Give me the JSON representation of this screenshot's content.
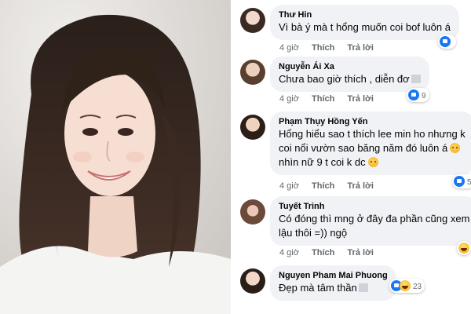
{
  "comments": [
    {
      "name": "Thư Hin",
      "text_lines": [
        "Vì bà ý mà t hổng muốn coi bof luôn á"
      ],
      "time": "4 giờ",
      "like_label": "Thích",
      "reply_label": "Trả lời",
      "reactions": [
        {
          "icon": "like-icon"
        }
      ],
      "reaction_count": ""
    },
    {
      "name": "Nguyễn Ái Xa",
      "text_lines": [
        "Chưa bao giờ thích , diễn đơ"
      ],
      "time": "4 giờ",
      "like_label": "Thích",
      "reply_label": "Trả lời",
      "reactions": [
        {
          "icon": "like-icon"
        }
      ],
      "reaction_count": "9"
    },
    {
      "name": "Phạm Thụy Hồng Yến",
      "text_lines": [
        "Hổng hiểu sao t thích lee min ho nhưng k",
        "coi nổi vườn sao băng năm đó luôn á",
        "nhìn nữ 9 t coi k dc"
      ],
      "time": "4 giờ",
      "like_label": "Thích",
      "reply_label": "Trả lời",
      "reactions": [
        {
          "icon": "like-icon"
        }
      ],
      "reaction_count": "5"
    },
    {
      "name": "Tuyết Trinh",
      "text_lines": [
        "Có đóng thì mng ở đây đa phần  cũng xem",
        "lậu thôi =)) ngộ"
      ],
      "time": "4 giờ",
      "like_label": "Thích",
      "reply_label": "Trả lời",
      "reactions": [
        {
          "icon": "haha-icon"
        }
      ],
      "reaction_count": ""
    },
    {
      "name": "Nguyen Pham Mai Phuong",
      "text_lines": [
        "Đẹp mà tâm thần"
      ],
      "time": "4 giờ",
      "like_label": "Thích",
      "reply_label": "Trả lời",
      "reactions": [
        {
          "icon": "like-icon"
        },
        {
          "icon": "haha-icon"
        }
      ],
      "reaction_count": "23"
    }
  ],
  "colors": {
    "bubble": "#f0f2f5",
    "meta_text": "#65676b",
    "like_blue": "#1877f2"
  }
}
